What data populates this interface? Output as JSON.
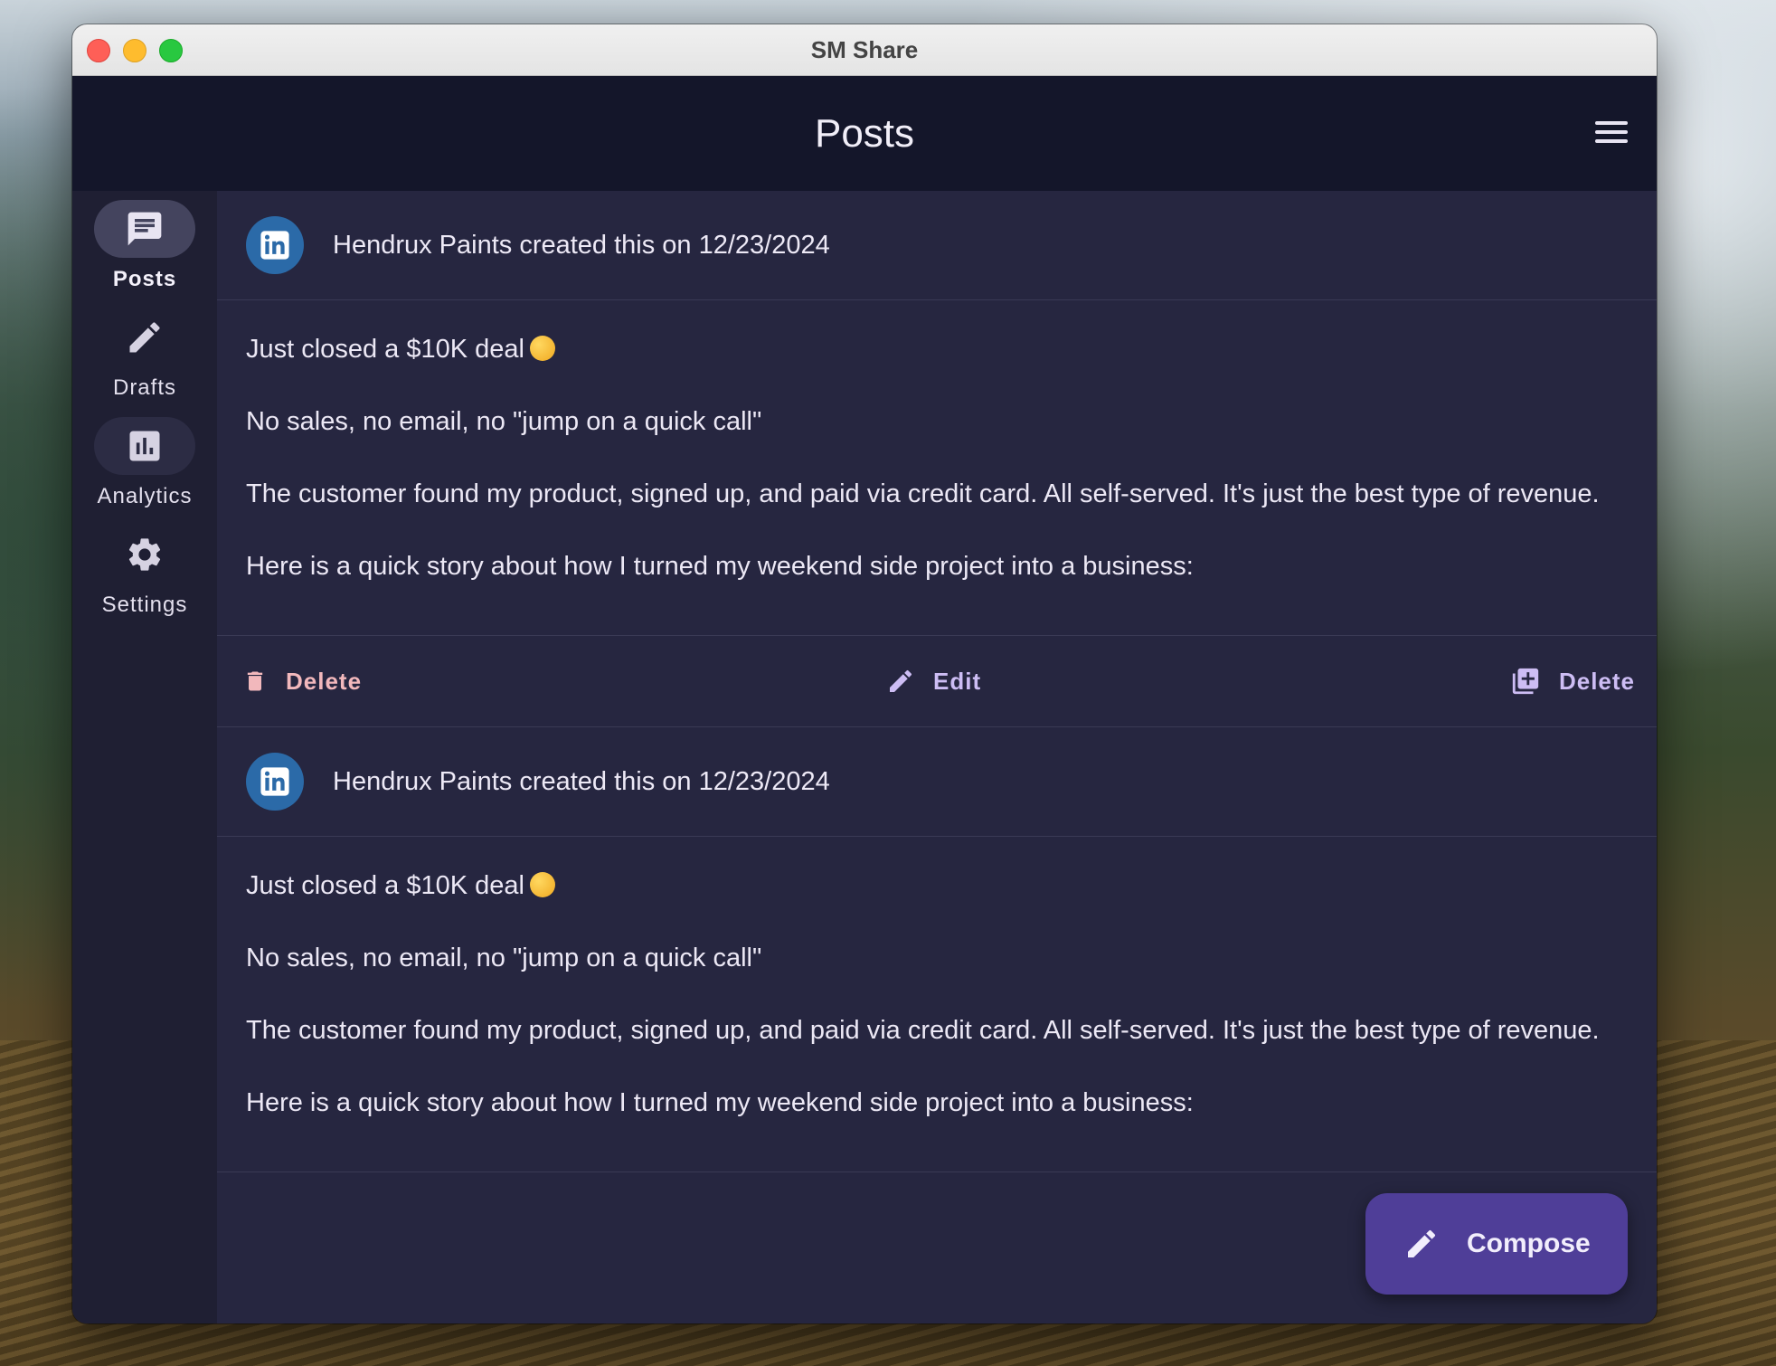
{
  "window": {
    "title": "SM Share"
  },
  "appbar": {
    "title": "Posts",
    "menu_icon": "hamburger-menu-icon"
  },
  "nav": {
    "items": [
      {
        "label": "Posts",
        "icon": "chat-bubble-icon",
        "active": true
      },
      {
        "label": "Drafts",
        "icon": "pencil-icon",
        "active": false
      },
      {
        "label": "Analytics",
        "icon": "bar-chart-icon",
        "active": false
      },
      {
        "label": "Settings",
        "icon": "gear-icon",
        "active": false
      }
    ]
  },
  "posts": [
    {
      "platform_icon": "linkedin-icon",
      "author_line": "Hendrux Paints created this on 12/23/2024",
      "paragraphs": [
        "Just closed a $10K deal",
        "No sales, no email, no \"jump on a quick call\"",
        "The customer found my product, signed up, and paid via credit card. All self-served. It's just the best type of revenue.",
        "Here is a quick story about how I turned my weekend side project into a business:"
      ],
      "actions": {
        "delete": "Delete",
        "edit": "Edit",
        "duplicate": "Delete"
      }
    },
    {
      "platform_icon": "linkedin-icon",
      "author_line": "Hendrux Paints created this on 12/23/2024",
      "paragraphs": [
        "Just closed a $10K deal",
        "No sales, no email, no \"jump on a quick call\"",
        "The customer found my product, signed up, and paid via credit card. All self-served. It's just the best type of revenue.",
        "Here is a quick story about how I turned my weekend side project into a business:"
      ]
    }
  ],
  "fab": {
    "label": "Compose",
    "icon": "pencil-icon"
  },
  "colors": {
    "appbar_bg": "#14162a",
    "feed_bg": "#262640",
    "rail_active": "#44445e",
    "delete_text": "#f2b8bc",
    "action_text": "#cdbdf4",
    "fab_bg": "#4f3e98",
    "linkedin_blue": "#2b6aa8"
  }
}
